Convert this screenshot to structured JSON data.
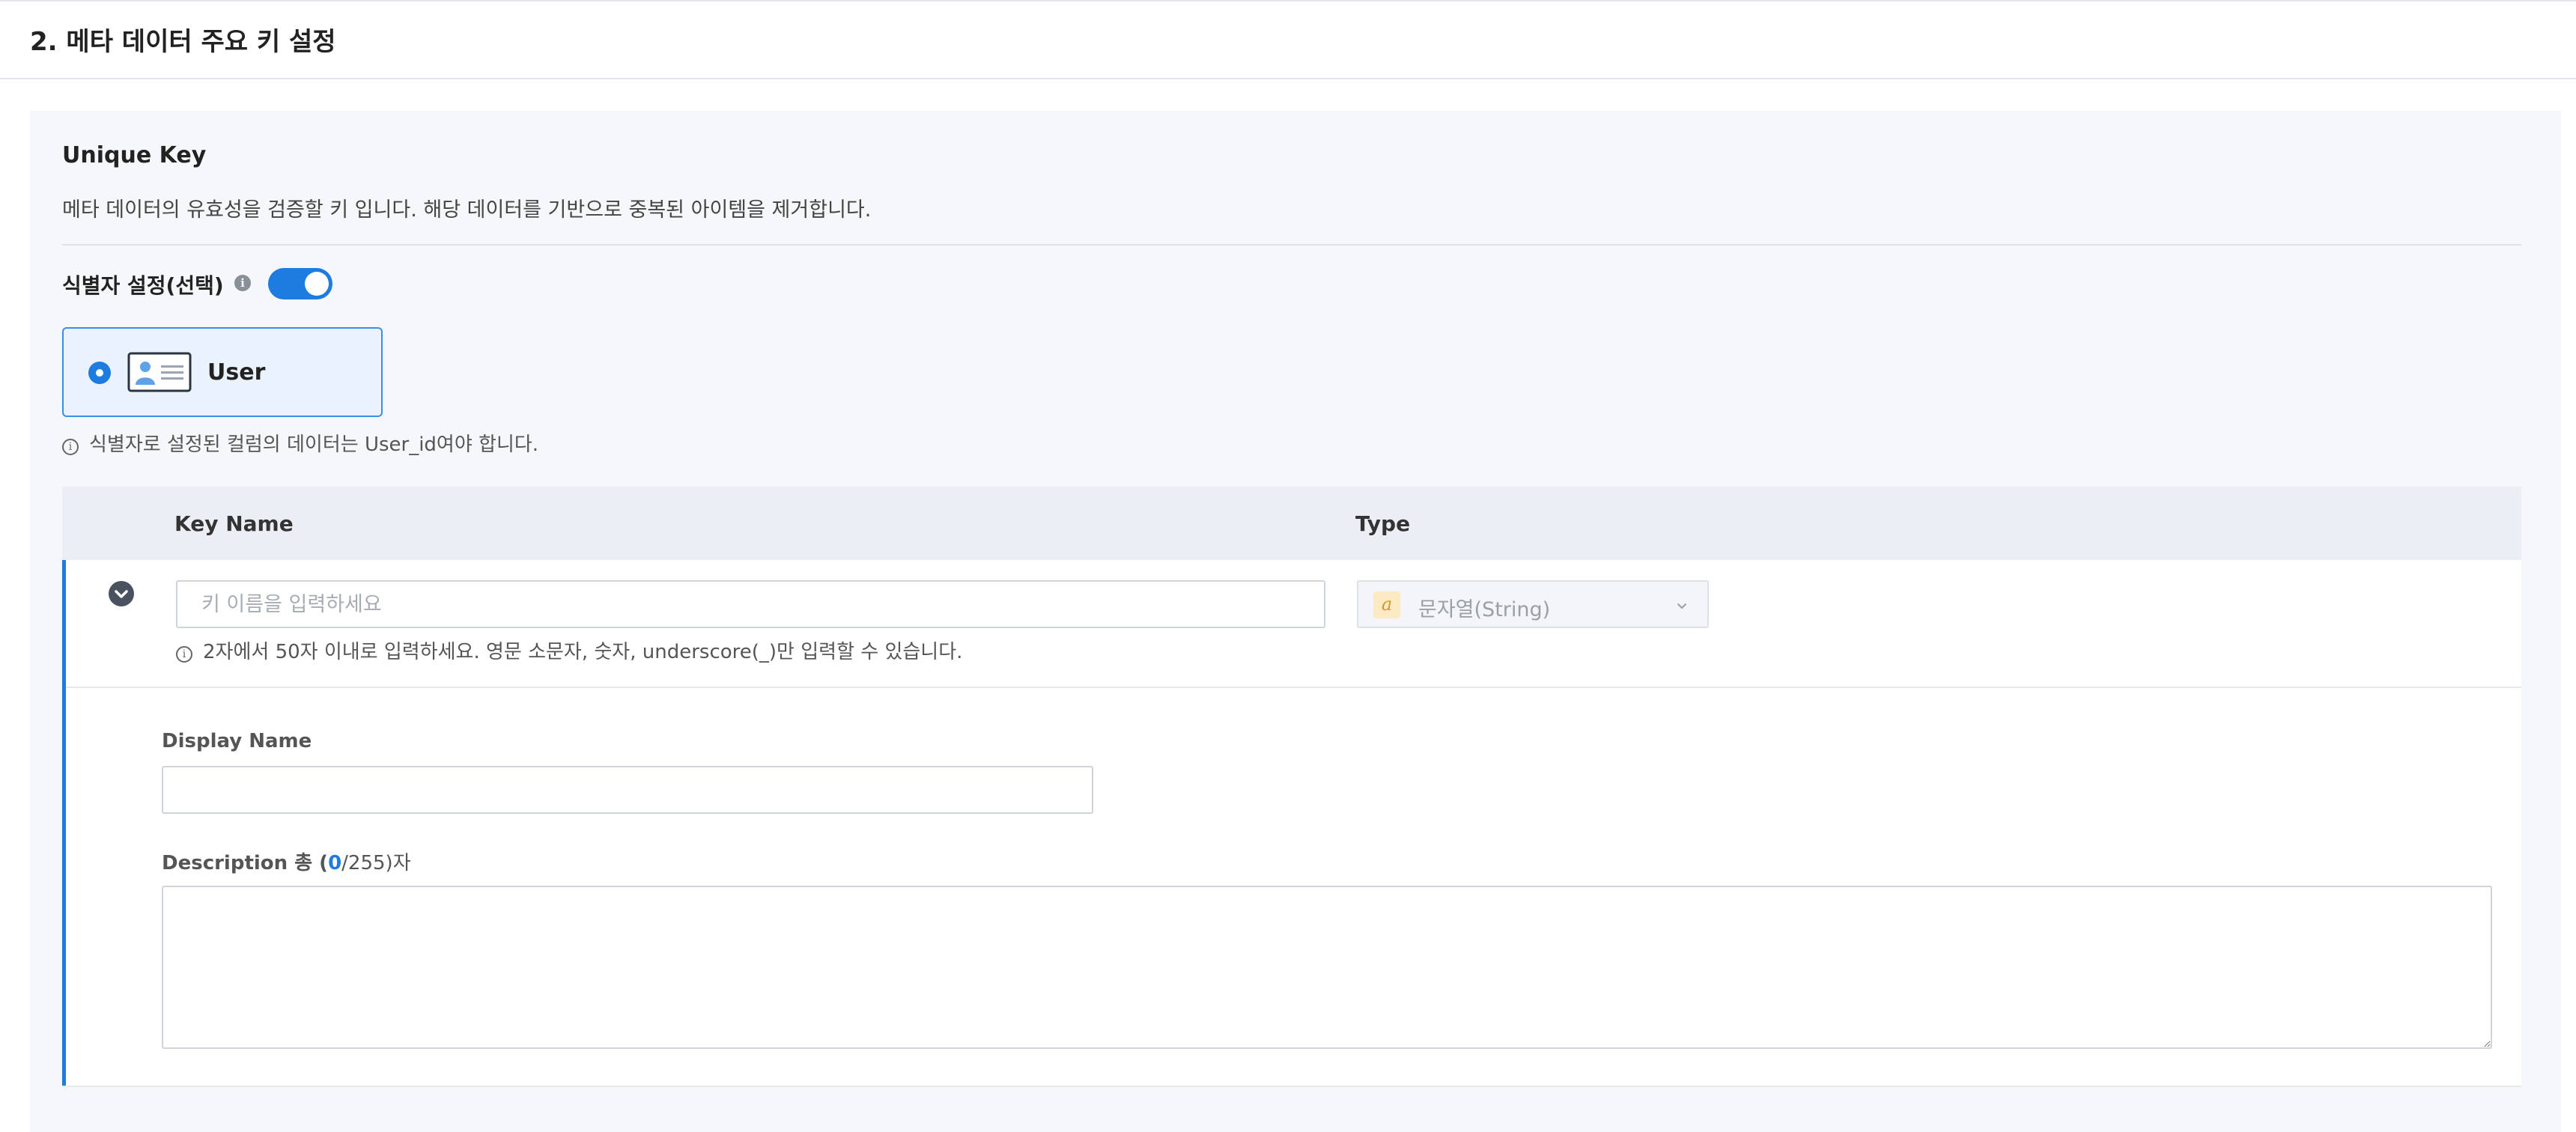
{
  "section": {
    "title": "2. 메타 데이터 주요 키 설정"
  },
  "unique_key": {
    "title": "Unique Key",
    "description": "메타 데이터의 유효성을 검증할 키 입니다. 해당 데이터를 기반으로 중복된 아이템을 제거합니다."
  },
  "identifier": {
    "label": "식별자 설정(선택)",
    "info_icon": "info-icon",
    "toggle_on": true,
    "option_label": "User",
    "option_icon": "id-card-icon",
    "help_text": "식별자로 설정된 컬럼의 데이터는 User_id여야 합니다."
  },
  "table": {
    "headers": {
      "key_name": "Key Name",
      "type": "Type"
    },
    "row": {
      "expand_icon": "chevron-down-icon",
      "key_placeholder": "키 이름을 입력하세요",
      "key_value": "",
      "key_help": "2자에서 50자 이내로 입력하세요. 영문 소문자, 숫자, underscore(_)만 입력할 수 있습니다.",
      "type_badge": "a",
      "type_value": "문자열(String)"
    }
  },
  "details": {
    "display_name_label": "Display Name",
    "display_name_value": "",
    "description_label_prefix": "Description 총 (",
    "description_count": "0",
    "description_label_suffix": "/255)자",
    "description_value": ""
  },
  "colors": {
    "accent": "#1e7be0",
    "panel_bg": "#f5f7fa",
    "header_bg": "#ebeff5",
    "card_bg": "#eaf3fd",
    "badge_bg": "#fbeac2"
  }
}
